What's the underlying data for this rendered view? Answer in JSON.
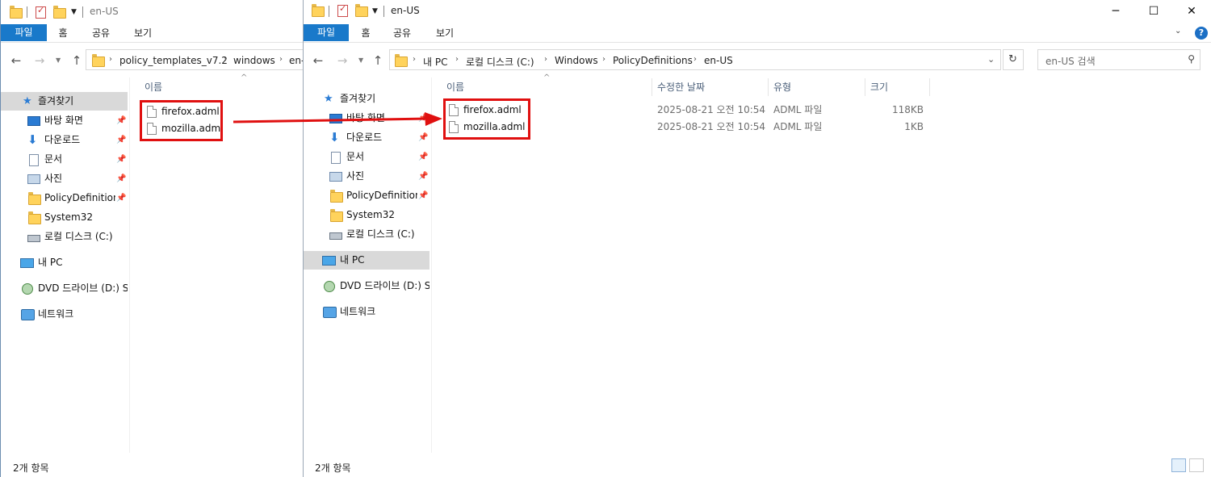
{
  "left_window": {
    "title": "en-US",
    "ribbon_tabs": [
      "파일",
      "홈",
      "공유",
      "보기"
    ],
    "breadcrumb": [
      "policy_templates_v7.2",
      "windows",
      "en-"
    ],
    "nav_items": [
      {
        "label": "즐겨찾기",
        "icon": "star-icon"
      },
      {
        "label": "바탕 화면",
        "icon": "desktop-icon",
        "pinned": true
      },
      {
        "label": "다운로드",
        "icon": "download-icon",
        "pinned": true
      },
      {
        "label": "문서",
        "icon": "document-icon",
        "pinned": true
      },
      {
        "label": "사진",
        "icon": "pictures-icon",
        "pinned": true
      },
      {
        "label": "PolicyDefinitions",
        "icon": "folder-icon",
        "pinned": true
      },
      {
        "label": "System32",
        "icon": "folder-icon"
      },
      {
        "label": "로컬 디스크 (C:)",
        "icon": "drive-icon"
      },
      {
        "label": "내 PC",
        "icon": "pc-icon"
      },
      {
        "label": "DVD 드라이브 (D:) S",
        "icon": "dvd-icon"
      },
      {
        "label": "네트워크",
        "icon": "network-icon"
      }
    ],
    "column_name": "이름",
    "files": [
      "firefox.adml",
      "mozilla.adml"
    ],
    "status": "2개 항목"
  },
  "right_window": {
    "title": "en-US",
    "ribbon_tabs": [
      "파일",
      "홈",
      "공유",
      "보기"
    ],
    "breadcrumb": [
      "내 PC",
      "로컬 디스크 (C:)",
      "Windows",
      "PolicyDefinitions",
      "en-US"
    ],
    "search_placeholder": "en-US 검색",
    "nav_items": [
      {
        "label": "즐겨찾기",
        "icon": "star-icon"
      },
      {
        "label": "바탕 화면",
        "icon": "desktop-icon",
        "pinned": true
      },
      {
        "label": "다운로드",
        "icon": "download-icon",
        "pinned": true
      },
      {
        "label": "문서",
        "icon": "document-icon",
        "pinned": true
      },
      {
        "label": "사진",
        "icon": "pictures-icon",
        "pinned": true
      },
      {
        "label": "PolicyDefinitions",
        "icon": "folder-icon",
        "pinned": true
      },
      {
        "label": "System32",
        "icon": "folder-icon"
      },
      {
        "label": "로컬 디스크 (C:)",
        "icon": "drive-icon"
      },
      {
        "label": "내 PC",
        "icon": "pc-icon",
        "selected": true
      },
      {
        "label": "DVD 드라이브 (D:) S",
        "icon": "dvd-icon"
      },
      {
        "label": "네트워크",
        "icon": "network-icon"
      }
    ],
    "columns": [
      "이름",
      "수정한 날짜",
      "유형",
      "크기"
    ],
    "files": [
      {
        "name": "firefox.adml",
        "modified": "2025-08-21 오전 10:54",
        "type": "ADML 파일",
        "size": "118KB"
      },
      {
        "name": "mozilla.adml",
        "modified": "2025-08-21 오전 10:54",
        "type": "ADML 파일",
        "size": "1KB"
      }
    ],
    "status": "2개 항목"
  },
  "colors": {
    "accent": "#1979ca",
    "highlight": "#e01010",
    "selection": "#d9d9d9"
  }
}
